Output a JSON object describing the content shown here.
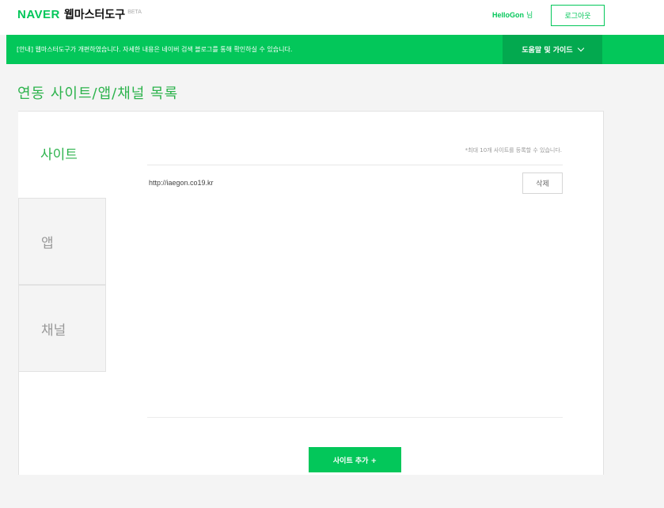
{
  "header": {
    "brand": "NAVER",
    "title": "웹마스터도구",
    "badge": "BETA",
    "user_name": "HelloGon",
    "user_suffix": "님",
    "logout_label": "로그아웃"
  },
  "notice": {
    "text": "[안내] 웹마스터도구가 개편하였습니다. 자세한 내용은 네이버 검색 블로그를 통해 확인하실 수 있습니다.",
    "help_label": "도움말 및 가이드"
  },
  "page": {
    "title": "연동 사이트/앱/채널 목록"
  },
  "tabs": [
    {
      "label": "사이트",
      "active": true
    },
    {
      "label": "앱",
      "active": false
    },
    {
      "label": "채널",
      "active": false
    }
  ],
  "sites": {
    "note": "*최대 10개 사이트를 등록할 수 있습니다.",
    "items": [
      {
        "url": "http://iaegon.co19.kr",
        "delete_label": "삭제"
      }
    ],
    "add_label": "사이트 추가 +"
  },
  "colors": {
    "brand_green": "#03c75a",
    "help_green": "#03a94f",
    "title_green": "#2db34d"
  }
}
